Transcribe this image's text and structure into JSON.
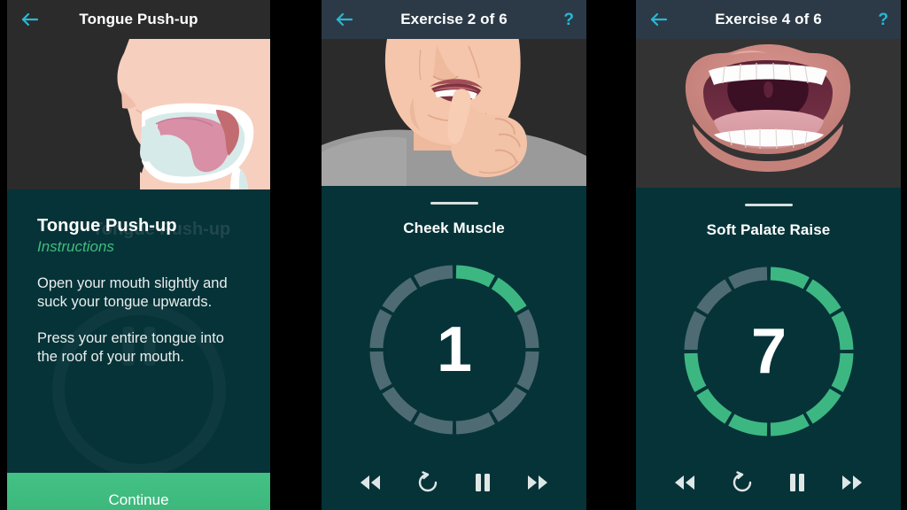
{
  "theme": {
    "panel_bg": "#063338",
    "header_dark": "#2b2b2b",
    "header_navy": "#2c3a47",
    "accent_cyan": "#28b8d4",
    "accent_green": "#3fbd7f",
    "ring_green": "#3db782",
    "ring_gray": "#4e6b73",
    "hero_bg": "#2b2b2b",
    "text_white": "#ffffff"
  },
  "panels": [
    {
      "id": "instructions",
      "header": {
        "title": "Tongue Push-up",
        "back_icon": "arrow-left-icon",
        "help_icon": null
      },
      "hero": {
        "illustration": "head-profile-tongue-anatomy-illustration"
      },
      "ghost_title": "Tongue Push-up",
      "title": "Tongue Push-up",
      "subtitle": "Instructions",
      "paragraphs": [
        "Open your mouth slightly and suck your tongue upwards.",
        "Press your entire tongue into the roof of your mouth."
      ],
      "continue_label": "Continue"
    },
    {
      "id": "exercise-2",
      "header": {
        "title": "Exercise 2 of 6",
        "back_icon": "arrow-left-icon",
        "help_icon": "question-mark-icon"
      },
      "hero": {
        "illustration": "person-finger-in-mouth-illustration"
      },
      "title": "Cheek Muscle",
      "timer": {
        "count": "1",
        "segments_total": 12,
        "segments_filled": 2
      },
      "controls": [
        {
          "name": "rewind-button",
          "icon": "rewind-icon"
        },
        {
          "name": "restart-button",
          "icon": "restart-icon"
        },
        {
          "name": "pause-button",
          "icon": "pause-icon"
        },
        {
          "name": "fast-forward-button",
          "icon": "fast-forward-icon"
        }
      ]
    },
    {
      "id": "exercise-4",
      "header": {
        "title": "Exercise 4 of 6",
        "back_icon": "arrow-left-icon",
        "help_icon": "question-mark-icon"
      },
      "hero": {
        "illustration": "open-mouth-soft-palate-illustration"
      },
      "title": "Soft Palate Raise",
      "timer": {
        "count": "7",
        "segments_total": 12,
        "segments_filled": 9
      },
      "controls": [
        {
          "name": "rewind-button",
          "icon": "rewind-icon"
        },
        {
          "name": "restart-button",
          "icon": "restart-icon"
        },
        {
          "name": "pause-button",
          "icon": "pause-icon"
        },
        {
          "name": "fast-forward-button",
          "icon": "fast-forward-icon"
        }
      ]
    }
  ]
}
